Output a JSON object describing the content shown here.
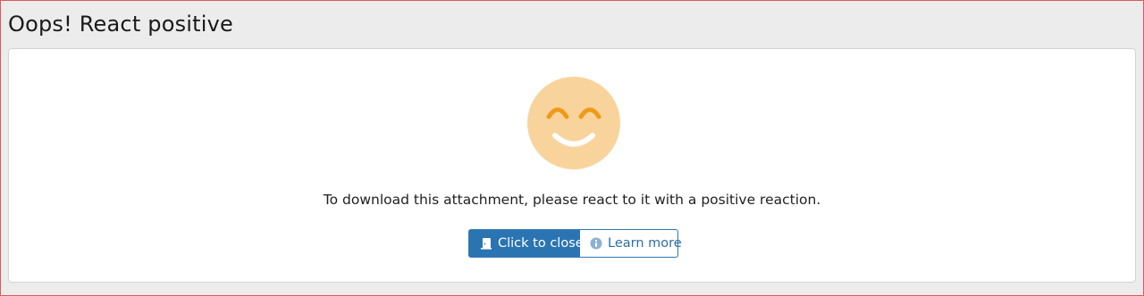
{
  "page": {
    "title": "Oops! React positive"
  },
  "notice": {
    "icon": "smiling-face-icon",
    "message": "To download this attachment, please react to it with a positive reaction."
  },
  "actions": {
    "close_label": "Click to close",
    "close_icon": "door-exit-icon",
    "learn_more_label": "Learn more",
    "learn_more_icon": "info-circle-icon"
  },
  "colors": {
    "primary": "#2b74b2",
    "face": "#f8d49c",
    "eyes": "#ef9a1a",
    "background": "#ececec"
  }
}
